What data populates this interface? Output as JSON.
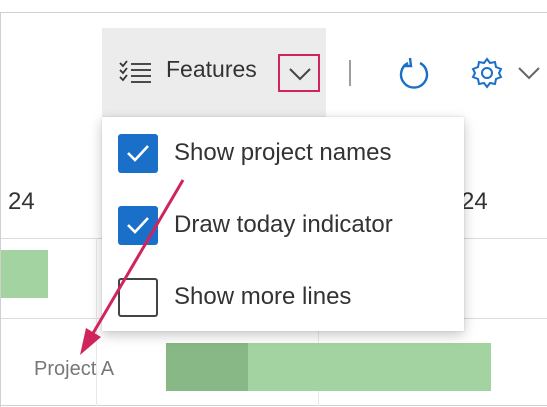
{
  "toolbar": {
    "features_label": "Features",
    "features_icon": "list-settings-icon",
    "dropdown_icon": "chevron-down-icon",
    "refresh_icon": "refresh-icon",
    "settings_icon": "gear-icon",
    "settings_dropdown_icon": "chevron-down-icon"
  },
  "timeline": {
    "columns": [
      "24",
      "24"
    ]
  },
  "rows": [
    {
      "label": "Project A"
    }
  ],
  "features_menu": {
    "items": [
      {
        "label": "Show project names",
        "checked": true
      },
      {
        "label": "Draw today indicator",
        "checked": true
      },
      {
        "label": "Show more lines",
        "checked": false
      }
    ]
  },
  "annotation": {
    "highlight_color": "#d0255a",
    "arrow_color": "#d0255a"
  },
  "colors": {
    "checkbox_checked": "#1a6fc8",
    "bar_light": "#a3d3a0",
    "bar_dark": "#87b885"
  }
}
